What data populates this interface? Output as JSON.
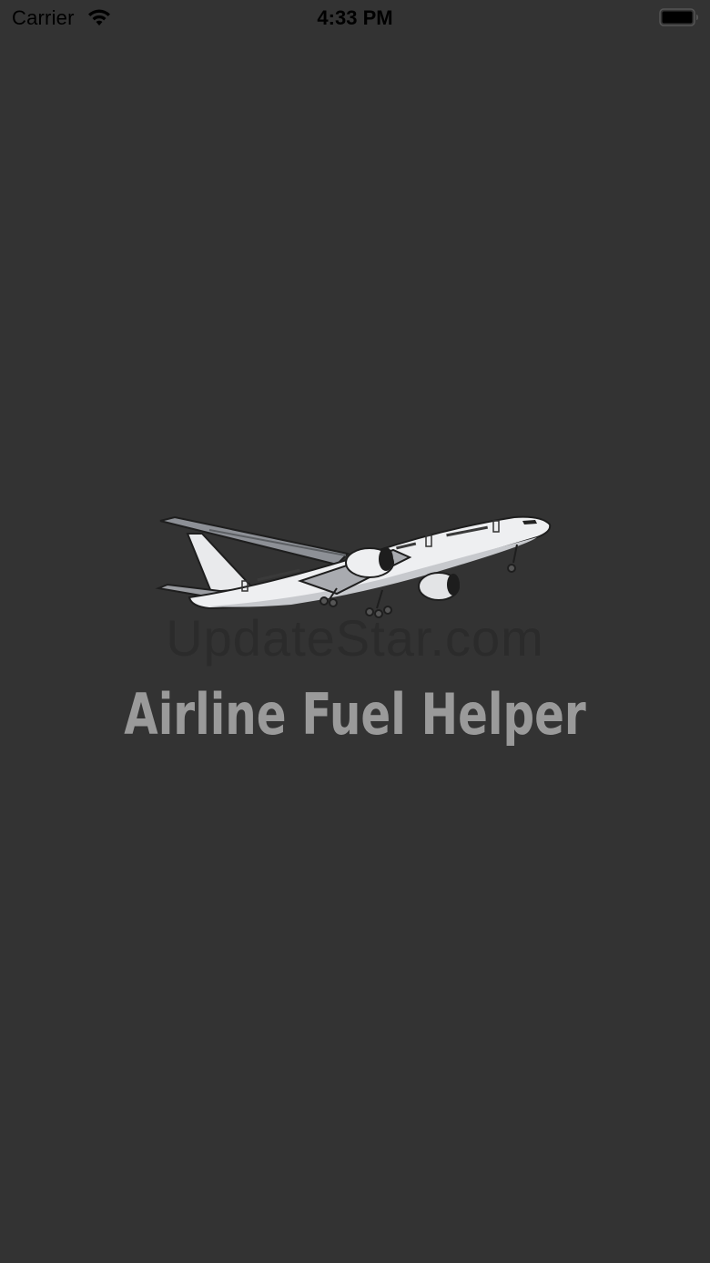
{
  "status_bar": {
    "carrier": "Carrier",
    "time": "4:33 PM",
    "wifi_icon": "wifi-icon",
    "battery_icon": "battery-icon"
  },
  "splash": {
    "image_icon": "airplane-icon",
    "watermark": "UpdateStar.com",
    "title": "Airline Fuel Helper"
  },
  "colors": {
    "background": "#333333",
    "title": "#9a9a9a",
    "status_text": "#000000"
  }
}
